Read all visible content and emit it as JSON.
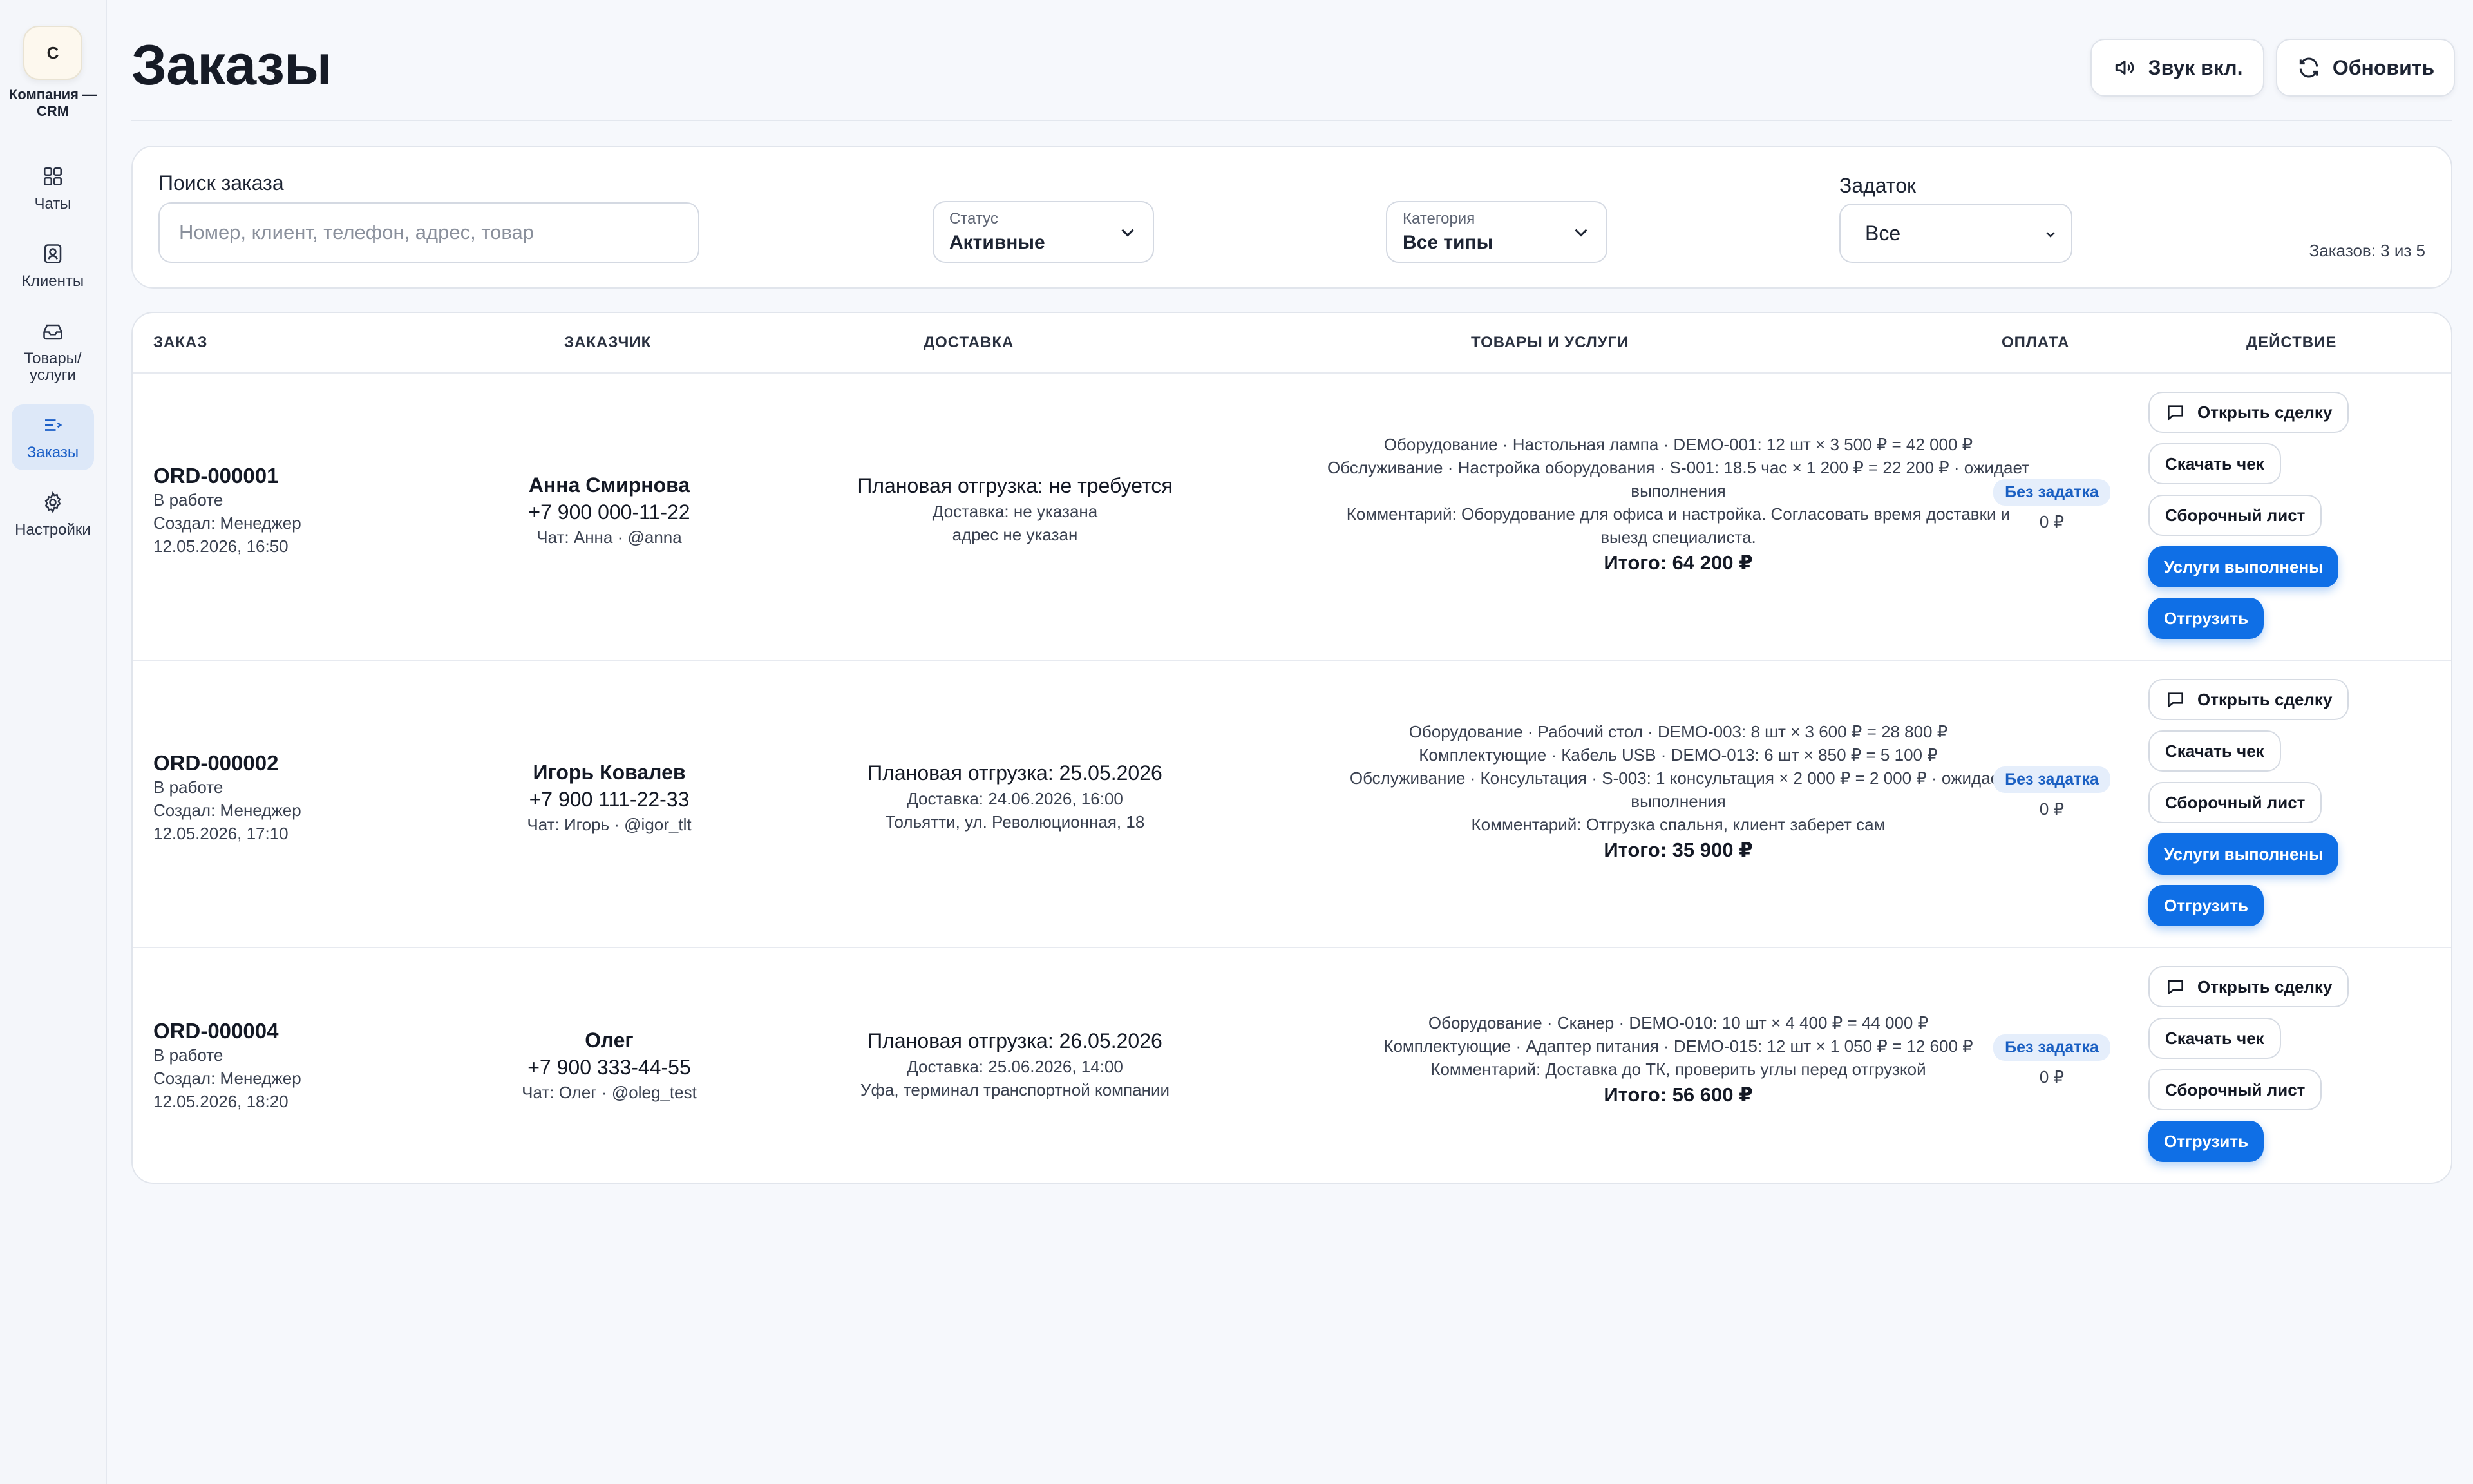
{
  "sidebar": {
    "logo_letter": "C",
    "company": "Компания — CRM",
    "items": [
      {
        "label": "Чаты",
        "icon": "grid-icon"
      },
      {
        "label": "Клиенты",
        "icon": "contacts-icon"
      },
      {
        "label": "Товары/ услуги",
        "icon": "inbox-icon"
      },
      {
        "label": "Заказы",
        "icon": "orders-list-icon"
      },
      {
        "label": "Настройки",
        "icon": "gear-icon"
      }
    ]
  },
  "header": {
    "title": "Заказы",
    "sound_label": "Звук вкл.",
    "refresh_label": "Обновить"
  },
  "filters": {
    "search_label": "Поиск заказа",
    "search_placeholder": "Номер, клиент, телефон, адрес, товар",
    "status_label": "Статус",
    "status_value": "Активные",
    "category_label": "Категория",
    "category_value": "Все типы",
    "deposit_label": "Задаток",
    "deposit_value": "Все",
    "orders_count": "Заказов: 3 из 5"
  },
  "table": {
    "columns": [
      "Заказ",
      "Заказчик",
      "Доставка",
      "Товары и услуги",
      "Оплата",
      "Действие"
    ],
    "rows": [
      {
        "id": "ORD-000001",
        "status": "В работе",
        "creator": "Создал: Менеджер",
        "created": "12.05.2026, 16:50",
        "customer": "Анна Смирнова",
        "phone": "+7 900 000-11-22",
        "chat": "Чат: Анна · @anna",
        "shipment": "Плановая отгрузка: не требуется",
        "delivery": "Доставка: не указана",
        "address": "адрес не указан",
        "goods": [
          "Оборудование · Настольная лампа · DEMO-001: 12 шт × 3 500 ₽ = 42 000 ₽",
          "Обслуживание · Настройка оборудования · S-001: 18.5 час × 1 200 ₽ = 22 200 ₽ · ожидает",
          "выполнения",
          "Комментарий: Оборудование для офиса и настройка. Согласовать время доставки и",
          "выезд специалиста."
        ],
        "total": "Итого: 64 200 ₽",
        "deposit_badge": "Без задатка",
        "paid": "0 ₽",
        "actions": {
          "open": "Открыть сделку",
          "receipt": "Скачать чек",
          "picklist": "Сборочный лист",
          "services_done": "Услуги выполнены",
          "ship": "Отгрузить"
        }
      },
      {
        "id": "ORD-000002",
        "status": "В работе",
        "creator": "Создал: Менеджер",
        "created": "12.05.2026, 17:10",
        "customer": "Игорь Ковалев",
        "phone": "+7 900 111-22-33",
        "chat": "Чат: Игорь · @igor_tlt",
        "shipment": "Плановая отгрузка: 25.05.2026",
        "delivery": "Доставка: 24.06.2026, 16:00",
        "address": "Тольятти, ул. Революционная, 18",
        "goods": [
          "Оборудование · Рабочий стол · DEMO-003: 8 шт × 3 600 ₽ = 28 800 ₽",
          "Комплектующие · Кабель USB · DEMO-013: 6 шт × 850 ₽ = 5 100 ₽",
          "Обслуживание · Консультация · S-003: 1 консультация × 2 000 ₽ = 2 000 ₽ · ожидает",
          "выполнения",
          "Комментарий: Отгрузка спальня, клиент заберет сам"
        ],
        "total": "Итого: 35 900 ₽",
        "deposit_badge": "Без задатка",
        "paid": "0 ₽",
        "actions": {
          "open": "Открыть сделку",
          "receipt": "Скачать чек",
          "picklist": "Сборочный лист",
          "services_done": "Услуги выполнены",
          "ship": "Отгрузить"
        }
      },
      {
        "id": "ORD-000004",
        "status": "В работе",
        "creator": "Создал: Менеджер",
        "created": "12.05.2026, 18:20",
        "customer": "Олег",
        "phone": "+7 900 333-44-55",
        "chat": "Чат: Олег · @oleg_test",
        "shipment": "Плановая отгрузка: 26.05.2026",
        "delivery": "Доставка: 25.06.2026, 14:00",
        "address": "Уфа, терминал транспортной компании",
        "goods": [
          "Оборудование · Сканер · DEMO-010: 10 шт × 4 400 ₽ = 44 000 ₽",
          "Комплектующие · Адаптер питания · DEMO-015: 12 шт × 1 050 ₽ = 12 600 ₽",
          "Комментарий: Доставка до ТК, проверить углы перед отгрузкой"
        ],
        "total": "Итого: 56 600 ₽",
        "deposit_badge": "Без задатка",
        "paid": "0 ₽",
        "actions": {
          "open": "Открыть сделку",
          "receipt": "Скачать чек",
          "picklist": "Сборочный лист",
          "ship": "Отгрузить"
        }
      }
    ]
  },
  "colors": {
    "accent": "#0f6fe6",
    "badge_bg": "#e5eefb",
    "badge_text": "#1a5fc2",
    "active_nav_bg": "#dde8f8"
  }
}
